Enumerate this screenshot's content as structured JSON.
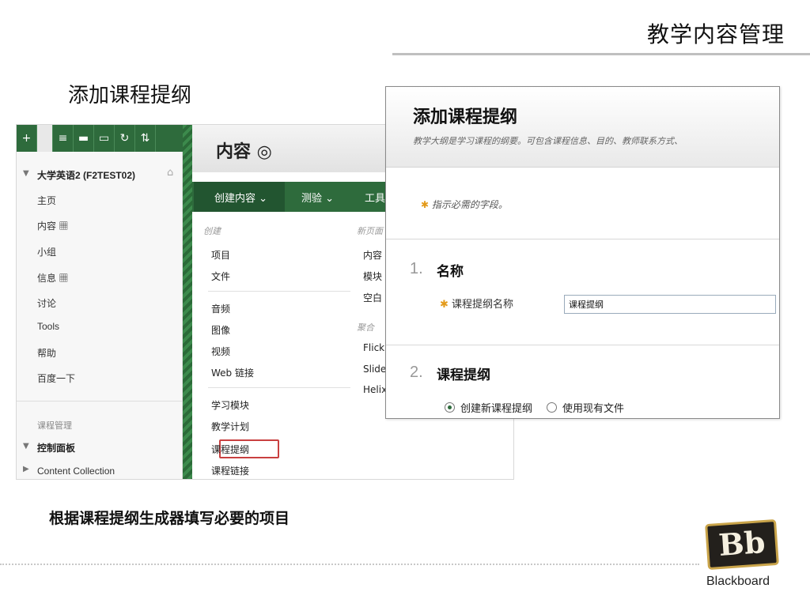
{
  "slide": {
    "title": "教学内容管理",
    "section_heading": "添加课程提纲",
    "caption": "根据课程提纲生成器填写必要的项目",
    "logo_text": "Bb",
    "logo_word": "Blackboard"
  },
  "lms": {
    "toolbar_icons": [
      "+",
      "≡",
      "▬",
      "▭",
      "↻",
      "⇅"
    ],
    "course_title": "大学英语2 (F2TEST02)",
    "nav_items": [
      "主页",
      "内容 ▦",
      "小组",
      "信息 ▦",
      "讨论",
      "Tools",
      "帮助",
      "百度一下"
    ],
    "course_management": "课程管理",
    "control_panel": "控制面板",
    "content_collection": "Content Collection",
    "page_title": "内容 ◎",
    "tabs": [
      "创建内容 ⌄",
      "测验 ⌄",
      "工具"
    ],
    "menu_create_head": "创建",
    "menu_create_items": [
      "项目",
      "文件",
      "音频",
      "图像",
      "视频",
      "Web 链接",
      "学习模块",
      "教学计划",
      "课程提纲",
      "课程链接"
    ],
    "menu_new_page_head": "新页面",
    "menu_new_page_items": [
      "内容",
      "模块",
      "空白"
    ],
    "menu_mashup_head": "聚合",
    "menu_mashup_items": [
      "Flickr",
      "Slide",
      "Helix"
    ]
  },
  "dialog": {
    "title": "添加课程提纲",
    "description": "教学大纲是学习课程的纲要。可包含课程信息、目的、教师联系方式、",
    "required_star": "✱",
    "required_note": "指示必需的字段。",
    "step1_num": "1.",
    "step1_title": "名称",
    "name_field_label": "课程提纲名称",
    "name_field_value": "课程提纲",
    "step2_num": "2.",
    "step2_title": "课程提纲",
    "radio_create_new": "创建新课程提纲",
    "radio_use_existing": "使用现有文件"
  }
}
